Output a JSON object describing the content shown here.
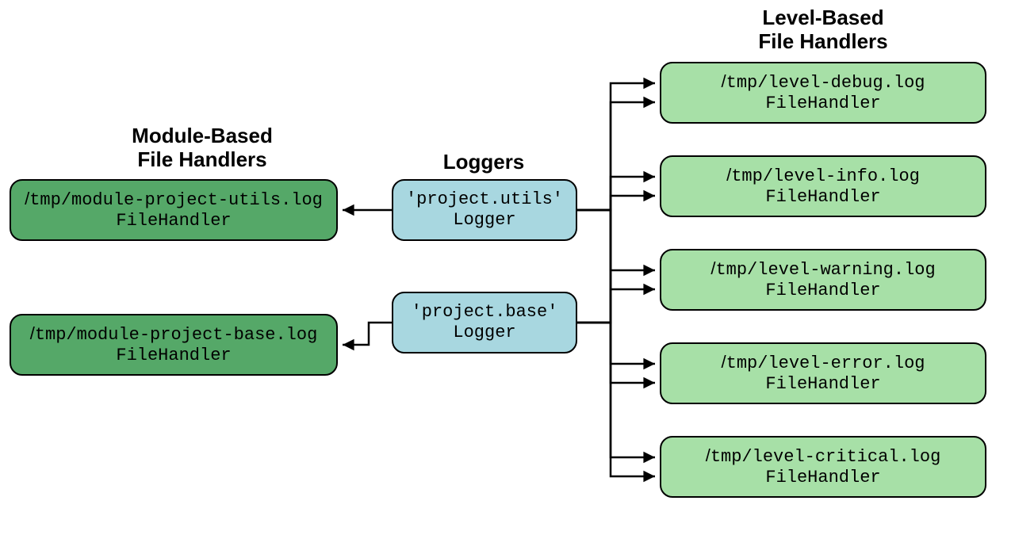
{
  "headings": {
    "module": "Module-Based\nFile Handlers",
    "loggers": "Loggers",
    "level": "Level-Based\nFile Handlers"
  },
  "module_handlers": [
    {
      "path": "/tmp/module-project-utils.log",
      "type": "FileHandler"
    },
    {
      "path": "/tmp/module-project-base.log",
      "type": "FileHandler"
    }
  ],
  "loggers": [
    {
      "name": "'project.utils'",
      "type": "Logger"
    },
    {
      "name": "'project.base'",
      "type": "Logger"
    }
  ],
  "level_handlers": [
    {
      "path": "/tmp/level-debug.log",
      "type": "FileHandler"
    },
    {
      "path": "/tmp/level-info.log",
      "type": "FileHandler"
    },
    {
      "path": "/tmp/level-warning.log",
      "type": "FileHandler"
    },
    {
      "path": "/tmp/level-error.log",
      "type": "FileHandler"
    },
    {
      "path": "/tmp/level-critical.log",
      "type": "FileHandler"
    }
  ],
  "colors": {
    "level_bg": "#a7e0a7",
    "module_bg": "#55a868",
    "logger_bg": "#a8d7e0",
    "stroke": "#000000"
  }
}
